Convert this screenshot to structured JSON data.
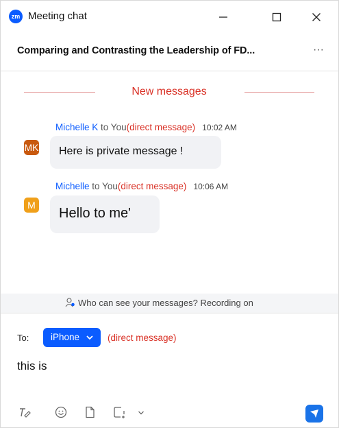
{
  "window": {
    "app_icon_text": "zm",
    "title": "Meeting chat",
    "controls": [
      "minimize-icon",
      "maximize-icon",
      "close-icon"
    ]
  },
  "header": {
    "meeting_title": "Comparing and Contrasting the Leadership of FD...",
    "more_label": "···"
  },
  "divider": {
    "label": "New messages"
  },
  "messages": [
    {
      "sender": "Michelle K",
      "to": " to You",
      "direct": "(direct message)",
      "time": "10:02 AM",
      "avatar_initials": "MK",
      "avatar_color": "#c8590f",
      "text": "Here is private message !"
    },
    {
      "sender": "Michelle",
      "to": " to You",
      "direct": "(direct message)",
      "time": "10:06 AM",
      "avatar_initials": "M",
      "avatar_color": "#f0a01a",
      "text": "Hello to me'"
    }
  ],
  "info": {
    "text": "Who can see your messages? Recording on",
    "icon": "people-icon"
  },
  "composer": {
    "to_label": "To:",
    "recipient": "iPhone",
    "direct": "(direct message)",
    "input_value": "this is",
    "toolbar_icons": [
      "format-icon",
      "emoji-icon",
      "file-icon",
      "screenshot-icon",
      "chevron-down-icon"
    ],
    "send_icon": "send-icon"
  },
  "colors": {
    "accent": "#0b5cff",
    "direct_message": "#d93025",
    "send": "#1a73e8"
  }
}
